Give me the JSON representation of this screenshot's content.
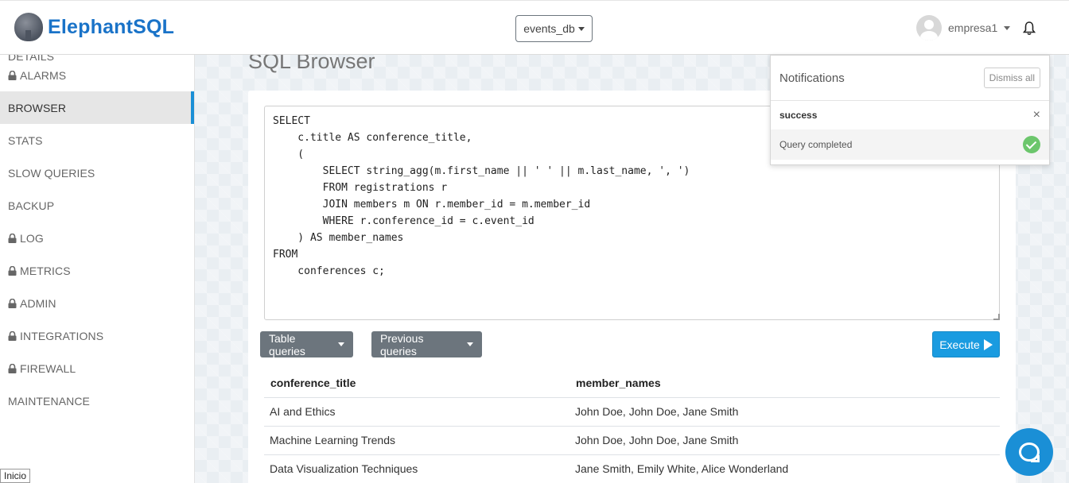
{
  "header": {
    "logo_text": "ElephantSQL",
    "db_selected": "events_db",
    "username": "empresa1"
  },
  "sidebar": {
    "items": [
      {
        "label": "DETAILS",
        "locked": false,
        "active": false
      },
      {
        "label": "ALARMS",
        "locked": true,
        "active": false
      },
      {
        "label": "BROWSER",
        "locked": false,
        "active": true
      },
      {
        "label": "STATS",
        "locked": false,
        "active": false
      },
      {
        "label": "SLOW QUERIES",
        "locked": false,
        "active": false
      },
      {
        "label": "BACKUP",
        "locked": false,
        "active": false
      },
      {
        "label": "LOG",
        "locked": true,
        "active": false
      },
      {
        "label": "METRICS",
        "locked": true,
        "active": false
      },
      {
        "label": "ADMIN",
        "locked": true,
        "active": false
      },
      {
        "label": "INTEGRATIONS",
        "locked": true,
        "active": false
      },
      {
        "label": "FIREWALL",
        "locked": true,
        "active": false
      },
      {
        "label": "MAINTENANCE",
        "locked": false,
        "active": false
      }
    ]
  },
  "main": {
    "title": "SQL Browser",
    "query": "SELECT\n    c.title AS conference_title,\n    (\n        SELECT string_agg(m.first_name || ' ' || m.last_name, ', ')\n        FROM registrations r\n        JOIN members m ON r.member_id = m.member_id\n        WHERE r.conference_id = c.event_id\n    ) AS member_names\nFROM\n    conferences c;",
    "table_queries_label": "Table queries",
    "previous_queries_label": "Previous queries",
    "execute_label": "Execute"
  },
  "results": {
    "columns": [
      "conference_title",
      "member_names"
    ],
    "rows": [
      [
        "AI and Ethics",
        "John Doe, John Doe, Jane Smith"
      ],
      [
        "Machine Learning Trends",
        "John Doe, John Doe, Jane Smith"
      ],
      [
        "Data Visualization Techniques",
        "Jane Smith, Emily White, Alice Wonderland"
      ]
    ]
  },
  "notifications": {
    "title": "Notifications",
    "dismiss_label": "Dismiss all",
    "item_title": "success",
    "item_message": "Query completed",
    "status_color": "#6cc66c"
  },
  "statusbar": {
    "text": "Inicio"
  },
  "colors": {
    "brand": "#1a73c8",
    "accent": "#1a8fd6",
    "execute": "#1a9be0",
    "secondary_button": "#6c757d"
  }
}
